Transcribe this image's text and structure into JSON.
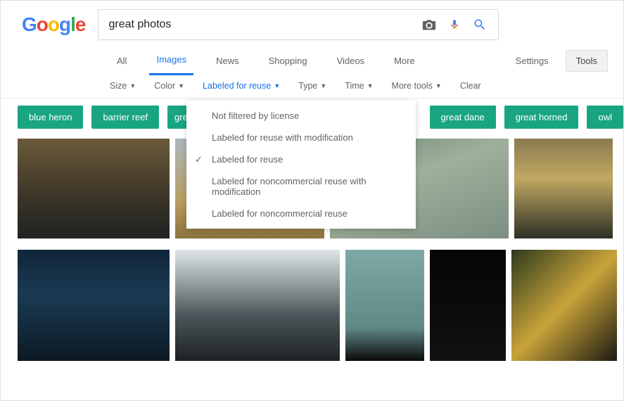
{
  "logo": {
    "letters": [
      "G",
      "o",
      "o",
      "g",
      "l",
      "e"
    ]
  },
  "search": {
    "value": "great photos"
  },
  "tabs": {
    "all": "All",
    "images": "Images",
    "news": "News",
    "shopping": "Shopping",
    "videos": "Videos",
    "more": "More",
    "settings": "Settings",
    "tools": "Tools"
  },
  "filters": {
    "size": "Size",
    "color": "Color",
    "rights": "Labeled for reuse",
    "type": "Type",
    "time": "Time",
    "moretools": "More tools",
    "clear": "Clear"
  },
  "dropdown": {
    "opt0": "Not filtered by license",
    "opt1": "Labeled for reuse with modification",
    "opt2": "Labeled for reuse",
    "opt3": "Labeled for noncommercial reuse with modification",
    "opt4": "Labeled for noncommercial reuse"
  },
  "chips": {
    "c0": "blue heron",
    "c1": "barrier reef",
    "c2": "great",
    "c3": "great dane",
    "c4": "great horned",
    "c5": "owl"
  }
}
